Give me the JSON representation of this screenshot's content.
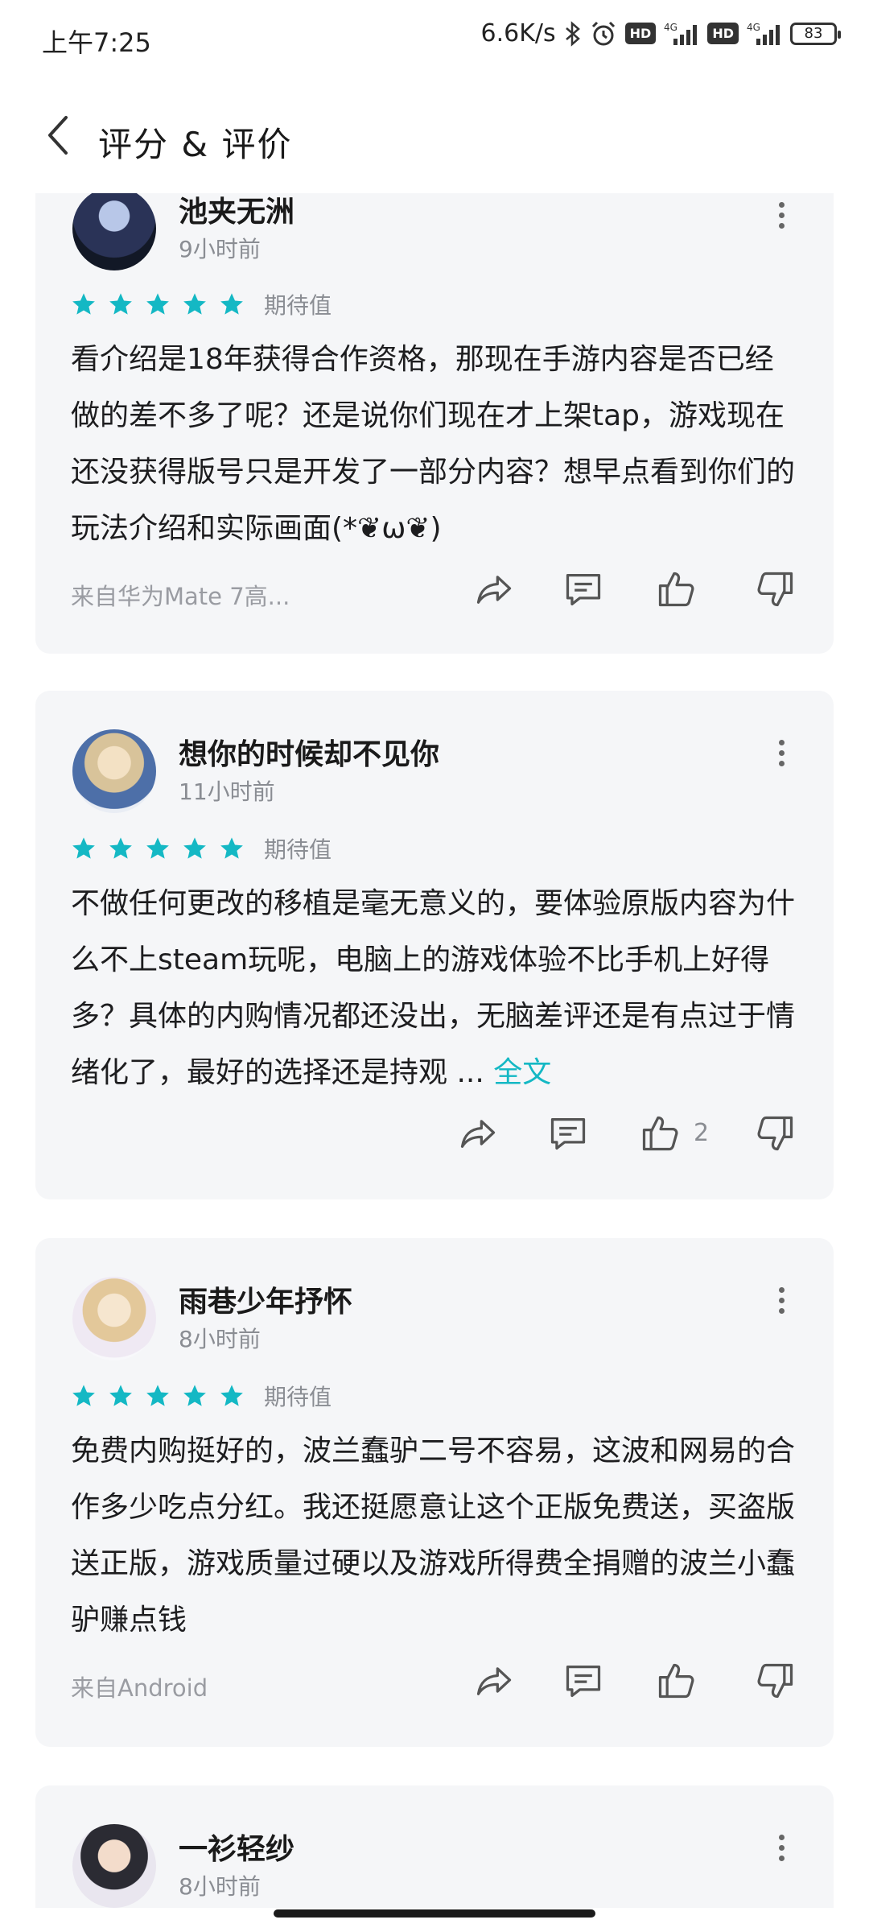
{
  "status_bar": {
    "time": "上午7:25",
    "net_speed": "6.6K/s",
    "hd_badge": "HD",
    "net_tag": "4G",
    "battery": "83"
  },
  "header": {
    "title": "评分 & 评价"
  },
  "reviews": [
    {
      "username": "池夹无洲",
      "time": "9小时前",
      "stars_label": "期待值",
      "text": "看介绍是18年获得合作资格，那现在手游内容是否已经做的差不多了呢？还是说你们现在才上架tap，游戏现在还没获得版号只是开发了一部分内容？想早点看到你们的玩法介绍和实际画面(*❦ω❦)",
      "device": "来自华为Mate 7高..."
    },
    {
      "username": "想你的时候却不见你",
      "time": "11小时前",
      "stars_label": "期待值",
      "text": "不做任何更改的移植是毫无意义的，要体验原版内容为什么不上steam玩呢，电脑上的游戏体验不比手机上好得多？具体的内购情况都还没出，无脑差评还是有点过于情绪化了，最好的选择还是持观 ...",
      "fulltext": "全文",
      "likes": "2"
    },
    {
      "username": "雨巷少年抒怀",
      "time": "8小时前",
      "stars_label": "期待值",
      "text": "免费内购挺好的，波兰蠢驴二号不容易，这波和网易的合作多少吃点分红。我还挺愿意让这个正版免费送，买盗版送正版，游戏质量过硬以及游戏所得费全捐赠的波兰小蠢驴赚点钱",
      "device": "来自Android"
    },
    {
      "username": "一衫轻纱",
      "time": "8小时前"
    }
  ],
  "colors": {
    "accent": "#14b8c4",
    "card_bg": "#f5f6f8",
    "star": "#14b8c4"
  },
  "icons": [
    "back-icon",
    "bluetooth-icon",
    "alarm-icon",
    "signal-icon",
    "battery-icon",
    "share-icon",
    "comment-icon",
    "thumbs-up-icon",
    "thumbs-down-icon",
    "more-icon",
    "star-icon"
  ]
}
